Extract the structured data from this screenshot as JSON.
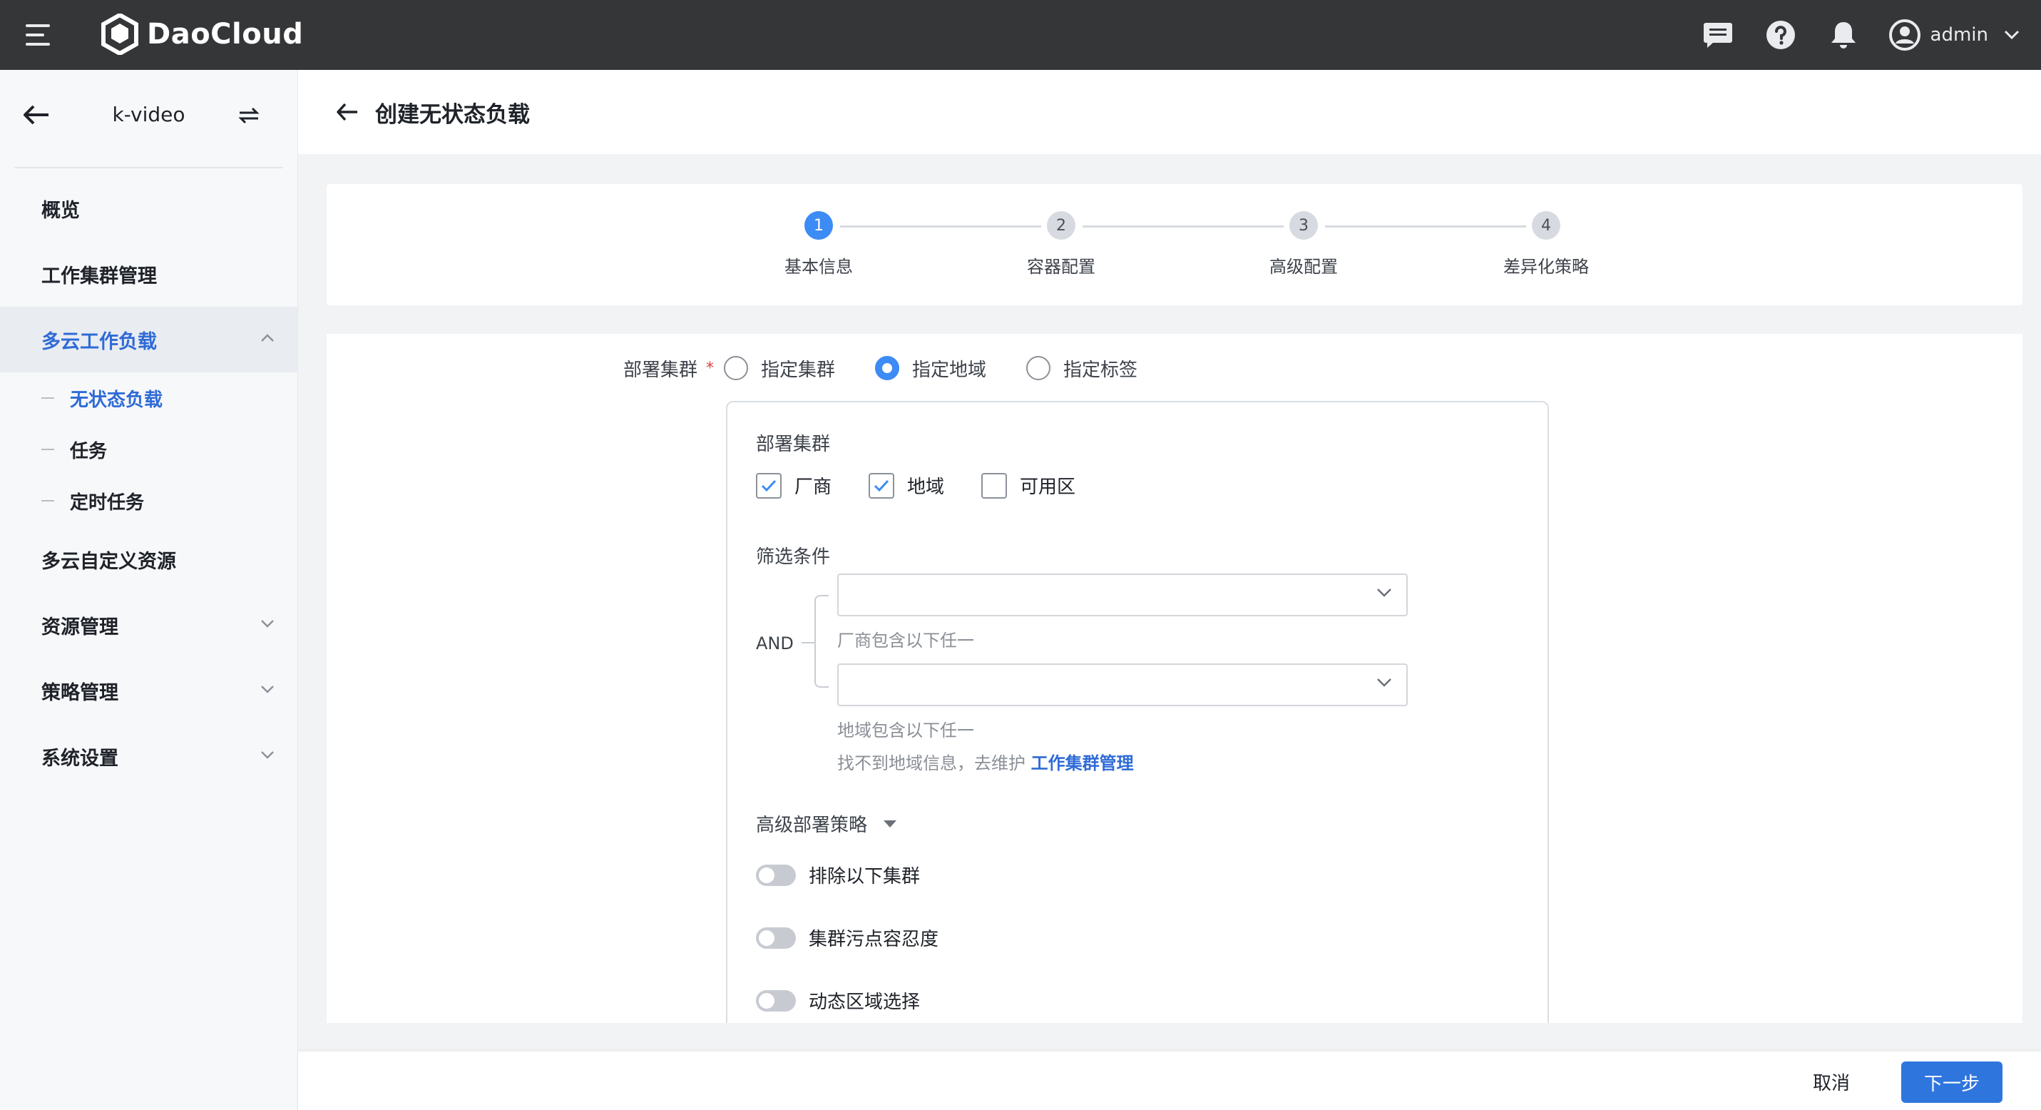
{
  "topbar": {
    "brand": "DaoCloud",
    "icons": [
      "menu-icon",
      "message-icon",
      "help-icon",
      "bell-icon",
      "user-icon",
      "chevron-down-icon"
    ],
    "username": "admin"
  },
  "sidebar": {
    "namespace": "k-video",
    "items": [
      {
        "label": "概览"
      },
      {
        "label": "工作集群管理"
      },
      {
        "label": "多云工作负载",
        "expanded": true
      },
      {
        "label": "多云自定义资源"
      },
      {
        "label": "资源管理"
      },
      {
        "label": "策略管理"
      },
      {
        "label": "系统设置"
      }
    ],
    "subitems": [
      {
        "label": "无状态负载",
        "active": true
      },
      {
        "label": "任务"
      },
      {
        "label": "定时任务"
      }
    ]
  },
  "page": {
    "title": "创建无状态负载"
  },
  "steps": [
    {
      "num": "1",
      "label": "基本信息",
      "active": true
    },
    {
      "num": "2",
      "label": "容器配置"
    },
    {
      "num": "3",
      "label": "高级配置"
    },
    {
      "num": "4",
      "label": "差异化策略"
    }
  ],
  "form": {
    "deploy_label": "部署集群",
    "required_mark": "*",
    "radios": [
      {
        "label": "指定集群",
        "checked": false
      },
      {
        "label": "指定地域",
        "checked": true
      },
      {
        "label": "指定标签",
        "checked": false
      }
    ],
    "inner": {
      "title": "部署集群",
      "checkboxes": [
        {
          "label": "厂商",
          "checked": true
        },
        {
          "label": "地域",
          "checked": true
        },
        {
          "label": "可用区",
          "checked": false
        }
      ],
      "filter_title": "筛选条件",
      "and_label": "AND",
      "select1": {
        "value": "",
        "hint": "厂商包含以下任一"
      },
      "select2": {
        "value": "",
        "hint": "地域包含以下任一"
      },
      "missing_hint": "找不到地域信息，去维护",
      "missing_link": "工作集群管理",
      "advanced_title": "高级部署策略",
      "toggles": [
        {
          "label": "排除以下集群",
          "on": false
        },
        {
          "label": "集群污点容忍度",
          "on": false
        },
        {
          "label": "动态区域选择",
          "on": false
        }
      ]
    }
  },
  "footer": {
    "cancel": "取消",
    "next": "下一步"
  },
  "colors": {
    "primary": "#2f75de",
    "step_active": "#3d8bf5",
    "topbar": "#353638"
  }
}
